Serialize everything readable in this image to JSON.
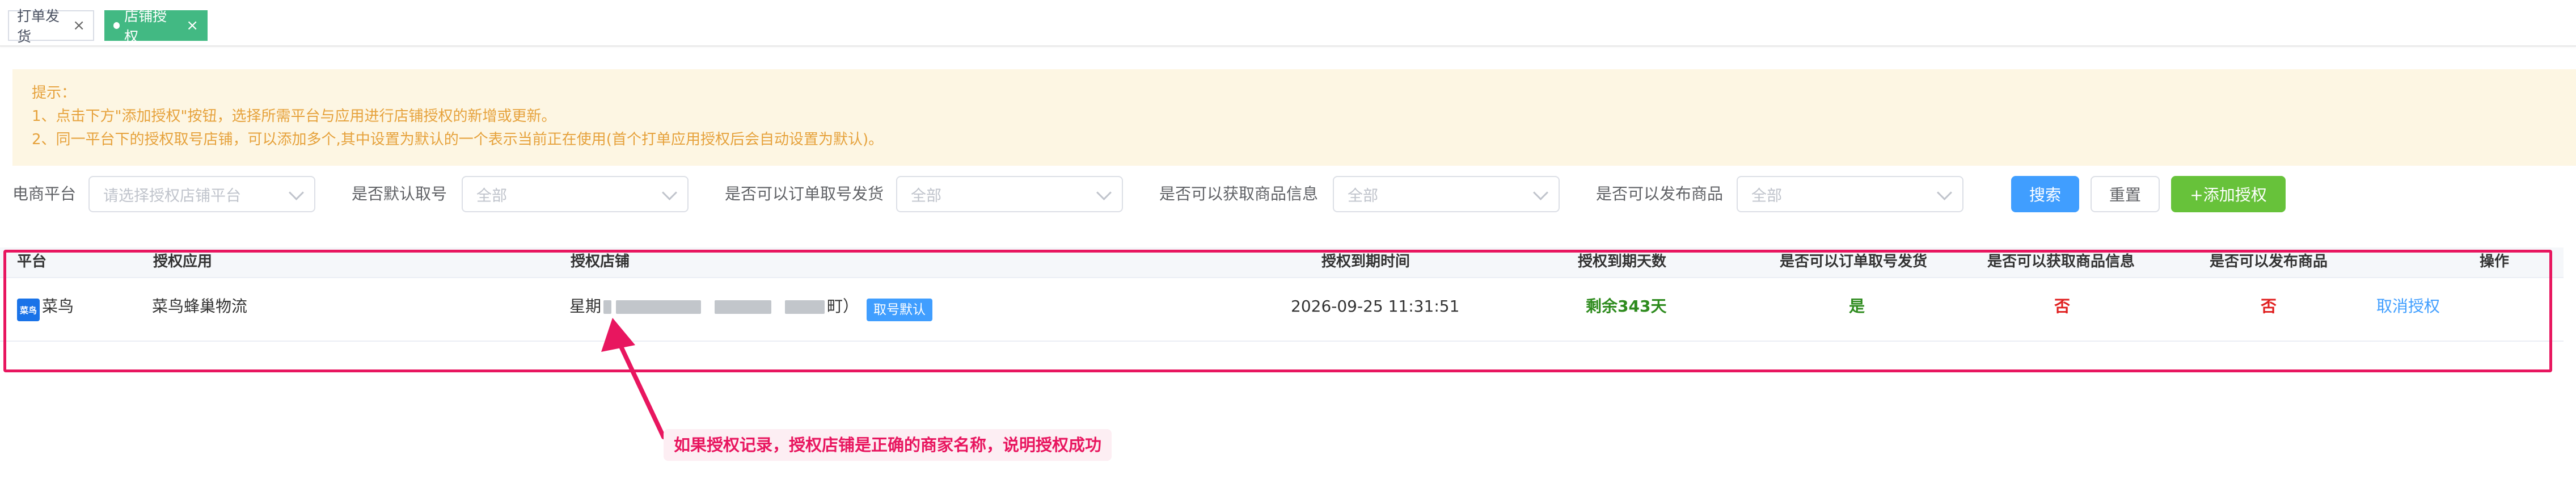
{
  "tabs": [
    {
      "label": "打单发货",
      "active": false
    },
    {
      "label": "店铺授权",
      "active": true
    }
  ],
  "tip": {
    "title": "提示：",
    "line1": "1、点击下方\"添加授权\"按钮，选择所需平台与应用进行店铺授权的新增或更新。",
    "line2": "2、同一平台下的授权取号店铺，可以添加多个,其中设置为默认的一个表示当前正在使用(首个打单应用授权后会自动设置为默认)。"
  },
  "filters": {
    "platform": {
      "label": "电商平台",
      "placeholder": "请选择授权店铺平台"
    },
    "default_fetch": {
      "label": "是否默认取号",
      "value": "全部"
    },
    "can_order_ship": {
      "label": "是否可以订单取号发货",
      "value": "全部"
    },
    "can_get_goods": {
      "label": "是否可以获取商品信息",
      "value": "全部"
    },
    "can_publish": {
      "label": "是否可以发布商品",
      "value": "全部"
    }
  },
  "buttons": {
    "search": "搜索",
    "reset": "重置",
    "add": "+添加授权"
  },
  "table": {
    "headers": [
      "平台",
      "授权应用",
      "授权店铺",
      "授权到期时间",
      "授权到期天数",
      "是否可以订单取号发货",
      "是否可以获取商品信息",
      "是否可以发布商品",
      "操作"
    ],
    "rows": [
      {
        "platform_icon_text": "菜鸟",
        "platform": "菜鸟",
        "app": "菜鸟蜂巢物流",
        "shop_prefix": "星期",
        "shop_suffix": "町）",
        "shop_tag": "取号默认",
        "expire_time": "2026-09-25 11:31:51",
        "days_left": "剩余343天",
        "can_order_ship": "是",
        "can_get_goods": "否",
        "can_publish": "否",
        "action": "取消授权"
      }
    ]
  },
  "annotation": {
    "note": "如果授权记录，授权店铺是正确的商家名称，说明授权成功",
    "color": "#e8165f"
  },
  "colors": {
    "primary": "#409eff",
    "success": "#67c23a",
    "tab_active": "#42b983",
    "warning_text": "#e6a23c"
  }
}
